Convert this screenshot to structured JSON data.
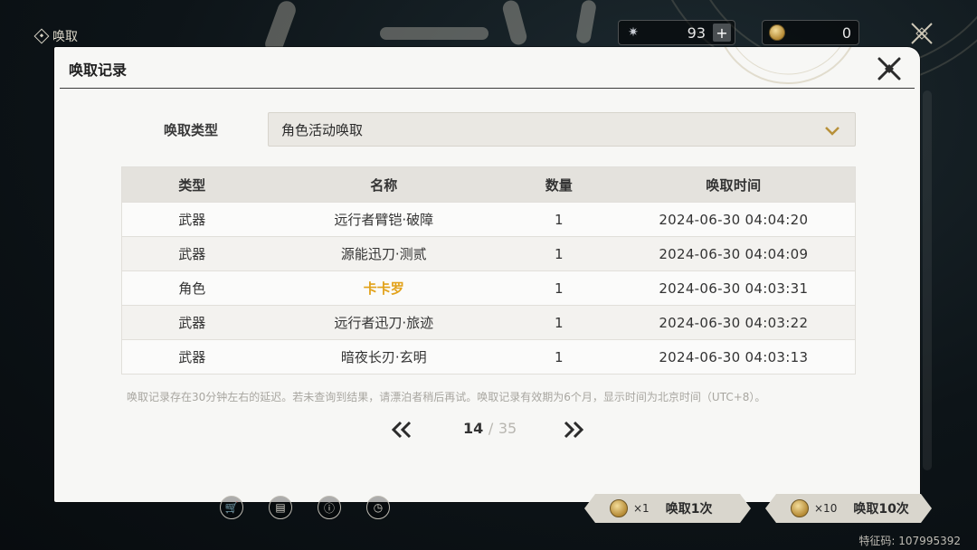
{
  "topbar": {
    "section_label": "唤取",
    "currency1": {
      "icon": "star-icon",
      "value": "93",
      "add_label": "+"
    },
    "currency2": {
      "icon": "coin-icon",
      "value": "0"
    }
  },
  "dialog": {
    "title": "唤取记录",
    "filter": {
      "label": "唤取类型",
      "selected": "角色活动唤取"
    },
    "table": {
      "headers": [
        "类型",
        "名称",
        "数量",
        "唤取时间"
      ],
      "rows": [
        {
          "type": "武器",
          "name": "远行者臂铠·破障",
          "qty": "1",
          "time": "2024-06-30 04:04:20"
        },
        {
          "type": "武器",
          "name": "源能迅刀·测贰",
          "qty": "1",
          "time": "2024-06-30 04:04:09"
        },
        {
          "type": "角色",
          "name": "卡卡罗",
          "qty": "1",
          "time": "2024-06-30 04:03:31"
        },
        {
          "type": "武器",
          "name": "远行者迅刀·旅迹",
          "qty": "1",
          "time": "2024-06-30 04:03:22"
        },
        {
          "type": "武器",
          "name": "暗夜长刃·玄明",
          "qty": "1",
          "time": "2024-06-30 04:03:13"
        }
      ]
    },
    "note": "唤取记录存在30分钟左右的延迟。若未查询到结果，请漂泊者稍后再试。唤取记录有效期为6个月，显示时间为北京时间（UTC+8）。",
    "pager": {
      "current": "14",
      "separator": "/",
      "total": "35"
    }
  },
  "bottom": {
    "pull1": {
      "mult": "×1",
      "label": "唤取1次"
    },
    "pull10": {
      "mult": "×10",
      "label": "唤取10次"
    },
    "feature_code": "特征码: 107995392"
  },
  "colors": {
    "highlight": "#e2a21a",
    "dialog_bg": "#f7f7f5"
  }
}
